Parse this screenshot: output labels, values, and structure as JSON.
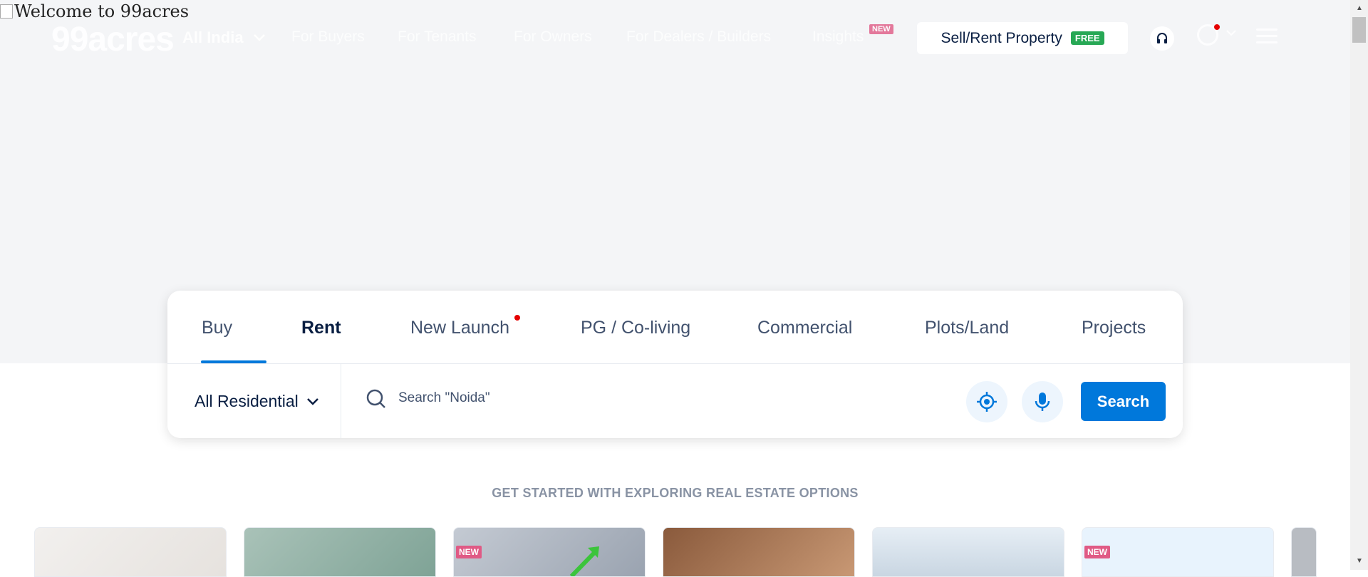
{
  "broken_image": {
    "alt": "Welcome to 99acres"
  },
  "header": {
    "logo": "99acres",
    "city": "All India",
    "nav": [
      "For Buyers",
      "For Tenants",
      "For Owners",
      "For Dealers / Builders",
      "Insights"
    ],
    "insights_badge": "NEW",
    "sell_label": "Sell/Rent Property",
    "free_badge": "FREE",
    "icons": [
      "headset-icon",
      "user-avatar-icon",
      "chevron-down-icon",
      "hamburger-icon"
    ]
  },
  "search": {
    "tabs": [
      "Buy",
      "Rent",
      "New Launch",
      "PG / Co-living",
      "Commercial",
      "Plots/Land",
      "Projects"
    ],
    "active_tab": "Buy",
    "property_type": "All Residential",
    "placeholder": "Search \"Noida\"",
    "search_button": "Search",
    "icons": [
      "search-icon",
      "locate-icon",
      "microphone-icon"
    ]
  },
  "explore": {
    "title": "GET STARTED WITH EXPLORING REAL ESTATE OPTIONS",
    "tiles": [
      {
        "badge": ""
      },
      {
        "badge": ""
      },
      {
        "badge": "NEW"
      },
      {
        "badge": ""
      },
      {
        "badge": ""
      },
      {
        "badge": "NEW"
      }
    ]
  },
  "colors": {
    "accent": "#0078db",
    "free": "#27a855",
    "new_badge": "#e05a85",
    "hero_bg": "#f4f5f7"
  }
}
